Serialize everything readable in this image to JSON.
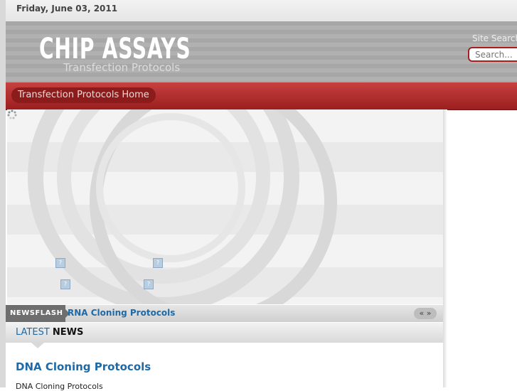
{
  "date": "Friday, June 03, 2011",
  "logo": {
    "title": "CHIP ASSAYS",
    "subtitle": "Transfection Protocols"
  },
  "search": {
    "label": "Site Search",
    "placeholder": "Search..."
  },
  "nav": {
    "home": "Transfection Protocols Home"
  },
  "slideshow": {
    "thumb_symbol": "?"
  },
  "newsflash": {
    "tag": "NEWSFLASH",
    "link": "RNA Cloning Protocols",
    "nav": "« »"
  },
  "latest": {
    "part1": "LATEST",
    "part2": "NEWS"
  },
  "article": {
    "title": "DNA Cloning Protocols",
    "text": "DNA Cloning Protocols"
  },
  "colors": {
    "accent_red": "#a81e1e",
    "link_blue": "#1e6aa8"
  },
  "icons": {
    "loader": "loading-spinner-icon"
  }
}
